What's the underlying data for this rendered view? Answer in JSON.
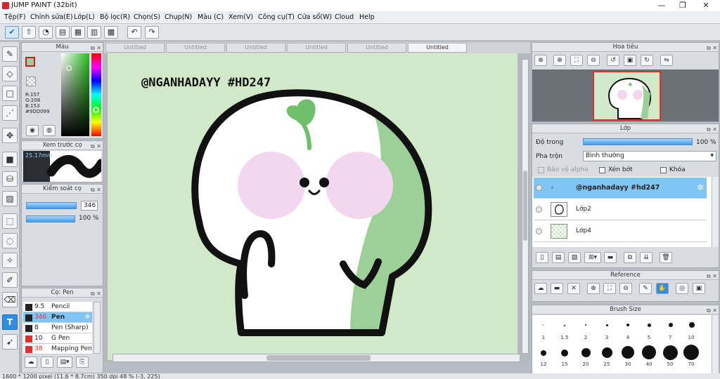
{
  "app": {
    "title": "JUMP PAINT (32bit)"
  },
  "window_buttons": {
    "minimize": "—",
    "maximize": "❐",
    "close": "✕"
  },
  "menu": [
    "Tệp(F)",
    "Chỉnh sửa(E)",
    "Lớp(L)",
    "Bộ lọc(R)",
    "Chọn(S)",
    "Chụp(N)",
    "Màu (C)",
    "Xem(V)",
    "Công cụ(T)",
    "Cửa sổ(W)",
    "Cloud",
    "Help"
  ],
  "tabs": [
    "Untitled",
    "Untitled",
    "Untitled",
    "Untitled",
    "Untitled",
    "Untitled"
  ],
  "active_tab_index": 5,
  "color_panel": {
    "title": "Màu",
    "r": "R:157",
    "g": "G:208",
    "b": "B:153",
    "hex": "#9DD099",
    "main_color": "#9dd099"
  },
  "brush_preview": {
    "title": "Xem trước cọ",
    "size": "25.17mm"
  },
  "brush_control": {
    "title": "Kiểm soát cọ",
    "size_value": "346",
    "opacity_value": "100 %"
  },
  "brush_list": {
    "title": "Cọ: Pen",
    "items": [
      {
        "size": "9.5",
        "name": "Pencil",
        "color": "#222222",
        "size_color": "#222222"
      },
      {
        "size": "346",
        "name": "Pen",
        "color": "#222222",
        "size_color": "#e0302a"
      },
      {
        "size": "8",
        "name": "Pen (Sharp)",
        "color": "#222222",
        "size_color": "#222222"
      },
      {
        "size": "10",
        "name": "G Pen",
        "color": "#e0302a",
        "size_color": "#222222"
      },
      {
        "size": "38",
        "name": "Mapping Pen",
        "color": "#e0302a",
        "size_color": "#e0302a"
      }
    ]
  },
  "canvas": {
    "watermark": "@NGANHADAYY #HD247"
  },
  "navigator": {
    "title": "Hoa tiêu"
  },
  "layers": {
    "title": "Lớp",
    "opacity_label": "Độ trong",
    "opacity_value": "100 %",
    "blend_label": "Pha trộn",
    "blend_value": "Bình thường",
    "protect_alpha": "Bảo vệ alpha",
    "clipping": "Xén bớt",
    "lock": "Khóa",
    "items": [
      {
        "name": "@nganhadayy #hd247",
        "selected": true
      },
      {
        "name": "Lớp2",
        "selected": false
      },
      {
        "name": "Lớp4",
        "selected": false
      }
    ]
  },
  "reference": {
    "title": "Reference"
  },
  "brush_size": {
    "title": "Brush Size",
    "row1": [
      "1",
      "1.5",
      "2",
      "3",
      "4",
      "5",
      "7",
      "10"
    ],
    "row2": [
      "12",
      "15",
      "20",
      "25",
      "30",
      "40",
      "50",
      "70"
    ]
  },
  "status": {
    "text": "1600 * 1200 pixel  (11.6 * 8.7cm)  350 dpi  48 %  (-3, 225)"
  }
}
